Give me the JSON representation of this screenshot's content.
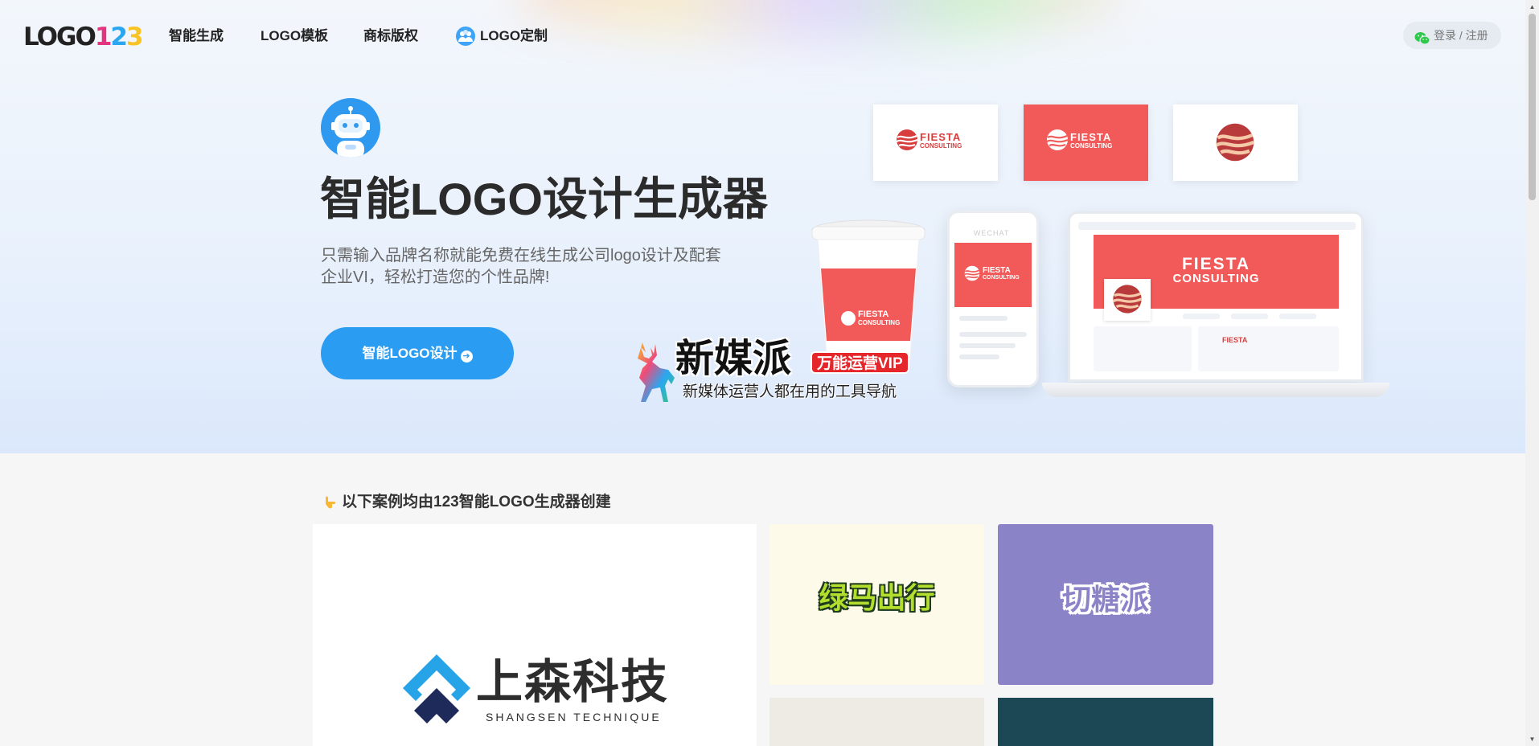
{
  "nav": {
    "brand_text": "LOGO",
    "brand_digits": [
      "1",
      "2",
      "3"
    ],
    "items": [
      {
        "label": "智能生成"
      },
      {
        "label": "LOGO模板"
      },
      {
        "label": "商标版权"
      },
      {
        "label": "LOGO定制"
      }
    ],
    "login_label": "登录 / 注册"
  },
  "hero": {
    "title": "智能LOGO设计生成器",
    "description": "只需输入品牌名称就能免费在线生成公司logo设计及配套企业VI，轻松打造您的个性品牌!",
    "cta_label": "智能LOGO设计",
    "mockup": {
      "brand_name": "FIESTA",
      "brand_sub": "CONSULTING",
      "phone_header": "WECHAT"
    }
  },
  "ad": {
    "title": "新媒派",
    "badge": "万能运营VIP",
    "subtitle": "新媒体运营人都在用的工具导航"
  },
  "section": {
    "title": "以下案例均由123智能LOGO生成器创建",
    "cases": [
      {
        "name": "上森科技",
        "en": "SHANGSEN TECHNIQUE"
      },
      {
        "name": "绿马出行"
      },
      {
        "name": "切糖派"
      }
    ]
  },
  "colors": {
    "primary": "#2a9cf2",
    "brand_red": "#f15a58",
    "case_purple": "#8b83c8",
    "case_dark_teal": "#1c4856"
  }
}
